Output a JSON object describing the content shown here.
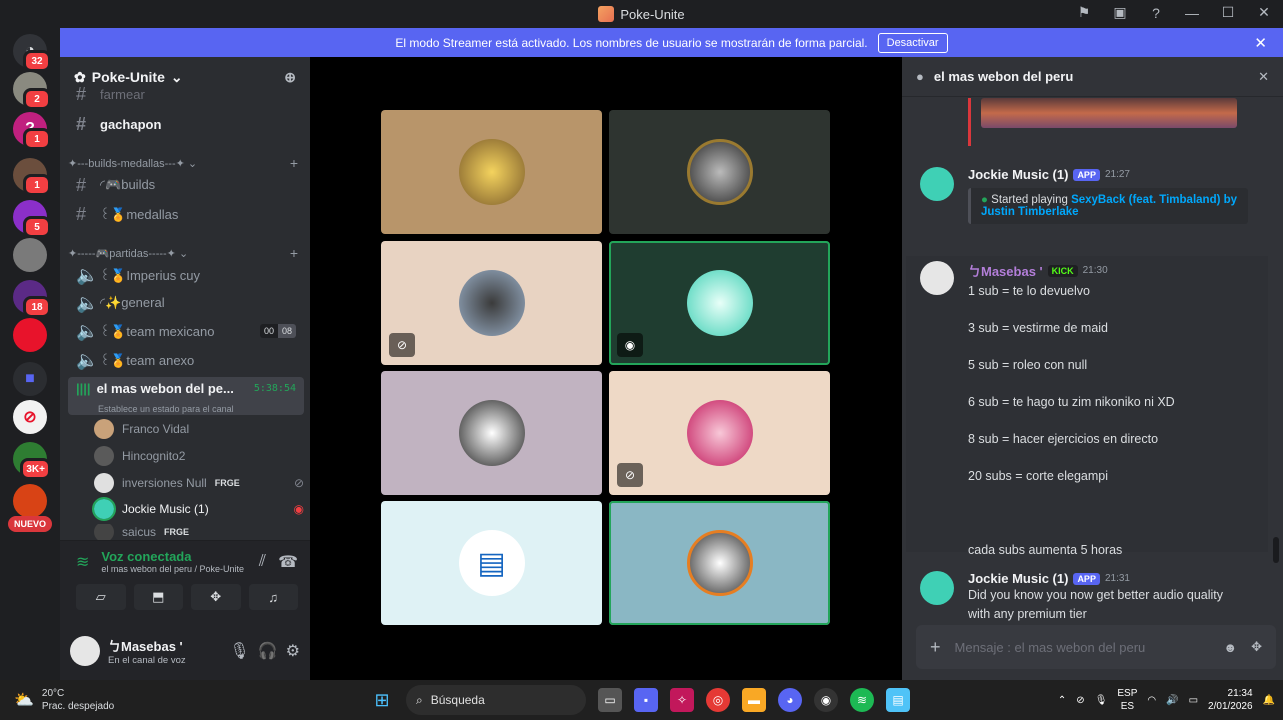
{
  "window": {
    "title": "Poke-Unite"
  },
  "banner": {
    "text": "El modo Streamer está activado. Los nombres de usuario se mostrarán de forma parcial.",
    "button": "Desactivar"
  },
  "servers": {
    "badges": [
      "32",
      "2",
      "1",
      "1",
      "5",
      "18",
      "3K+"
    ],
    "new_label": "NUEVO"
  },
  "guild": {
    "name": "Poke-Unite"
  },
  "channels": {
    "partial_top": "farmear",
    "gachapon": "gachapon",
    "cat_builds": "✦---builds-medallas---✦",
    "builds": "◜🎮builds",
    "medallas": "꒰🏅medallas",
    "cat_partidas": "✦-----🎮partidas-----✦",
    "imperius": "꒰🏅Imperius cuy",
    "general": "◜✨general",
    "team_mex": "꒰🏅team mexicano",
    "team_mex_count_a": "00",
    "team_mex_count_b": "08",
    "team_anexo": "꒰🏅team anexo",
    "active_voice": "el mas webon del pe...",
    "active_timer": "5:38:54",
    "active_status": "Establece un estado para el canal"
  },
  "members": [
    {
      "name": "Franco Vidal",
      "tag": ""
    },
    {
      "name": "Hincognito2",
      "tag": ""
    },
    {
      "name": "inversiones Null",
      "tag": "FRGE"
    },
    {
      "name": "Jockie Music (1)",
      "tag": ""
    },
    {
      "name": "saicus",
      "tag": "FRGE"
    }
  ],
  "voice": {
    "status": "Voz conectada",
    "channel": "el mas webon del peru / Poke-Unite"
  },
  "user": {
    "name": "ㄅMasebas '",
    "status": "En el canal de voz"
  },
  "chat": {
    "header": "el mas webon del peru",
    "msg1": {
      "user": "Jockie Music (1)",
      "tag": "APP",
      "time": "21:27",
      "embed_prefix": "Started playing",
      "embed_song": "SexyBack (feat. Timbaland) by Justin Timberlake"
    },
    "msg2": {
      "user": "ㄅMasebas '",
      "tag": "KICK",
      "time": "21:30",
      "lines": [
        "1 sub = te lo devuelvo",
        "3 sub  = vestirme de maid",
        "5 sub = roleo con null",
        "6 sub = te hago tu zim nikoniko ni XD",
        "8 sub = hacer ejercicios en directo",
        "20 subs = corte elegampi",
        "cada subs aumenta 5 horas"
      ]
    },
    "msg3": {
      "user": "Jockie Music (1)",
      "tag": "APP",
      "time": "21:31",
      "text": "Did you know you now get better audio quality with any premium tier"
    },
    "composer_placeholder": "Mensaje  : el mas webon del peru"
  },
  "taskbar": {
    "weather_temp": "20°C",
    "weather_desc": "Prac. despejado",
    "search": "Búsqueda",
    "lang1": "ESP",
    "lang2": "ES",
    "time": "21:34",
    "date": "2/01/2026"
  }
}
